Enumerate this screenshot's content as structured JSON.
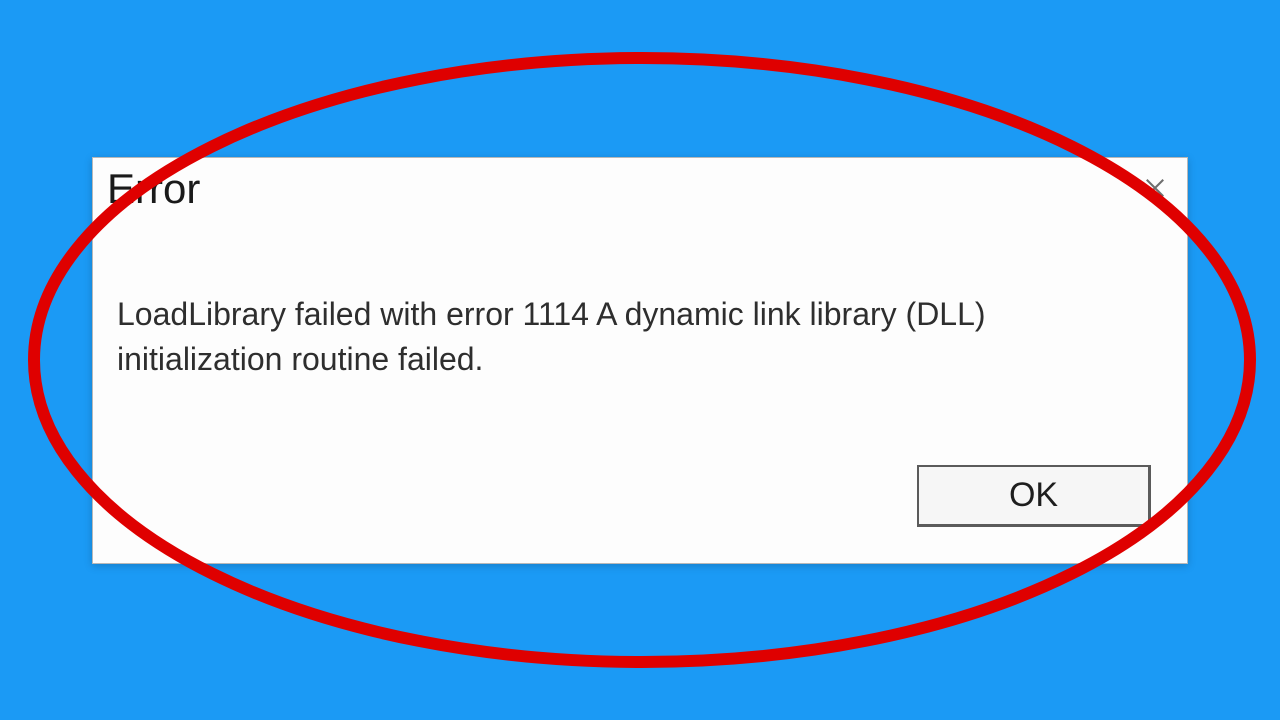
{
  "dialog": {
    "title": "Error",
    "message": "LoadLibrary failed with error 1114 A dynamic link library (DLL) initialization routine failed.",
    "ok_label": "OK"
  }
}
